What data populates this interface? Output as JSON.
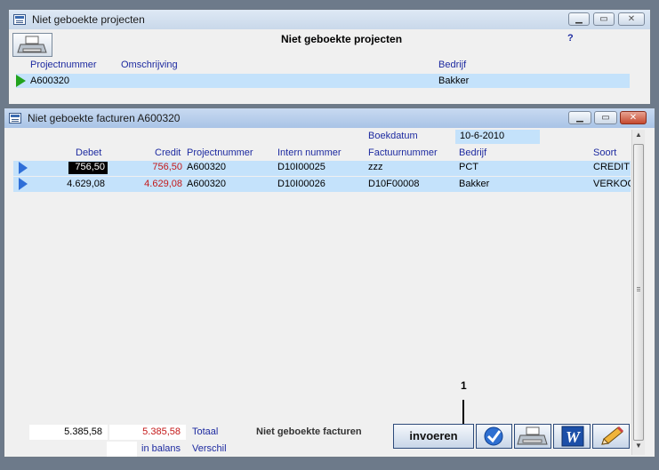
{
  "project_window": {
    "title": "Niet geboekte projecten",
    "heading": "Niet geboekte projecten",
    "help": "?",
    "columns": {
      "projectnummer": "Projectnummer",
      "omschrijving": "Omschrijving",
      "bedrijf": "Bedrijf"
    },
    "row": {
      "projectnummer": "A600320",
      "omschrijving": "",
      "bedrijf": "Bakker"
    }
  },
  "invoice_window": {
    "title": "Niet geboekte facturen A600320",
    "boekdatum_label": "Boekdatum",
    "boekdatum_value": "10-6-2010",
    "columns": {
      "debet": "Debet",
      "credit": "Credit",
      "projectnummer": "Projectnummer",
      "intern": "Intern nummer",
      "factuur": "Factuurnummer",
      "bedrijf": "Bedrijf",
      "soort": "Soort"
    },
    "rows": [
      {
        "debet": "756,50",
        "credit": "756,50",
        "projectnummer": "A600320",
        "intern": "D10I00025",
        "factuur": "zzz",
        "bedrijf": "PCT",
        "soort": "CREDIT"
      },
      {
        "debet": "4.629,08",
        "credit": "4.629,08",
        "projectnummer": "A600320",
        "intern": "D10I00026",
        "factuur": "D10F00008",
        "bedrijf": "Bakker",
        "soort": "VERKOOP"
      }
    ],
    "totals": {
      "debet_total": "5.385,58",
      "credit_total": "5.385,58",
      "totaal_label": "Totaal",
      "balans_label": "in balans",
      "verschil_label": "Verschil",
      "footer_caption": "Niet geboekte facturen"
    },
    "callout": "1",
    "buttons": {
      "invoeren": "invoeren"
    }
  },
  "colors": {
    "selection": "#c4e2fb",
    "red_value": "#c41818",
    "header_blue": "#1d2aa0"
  }
}
